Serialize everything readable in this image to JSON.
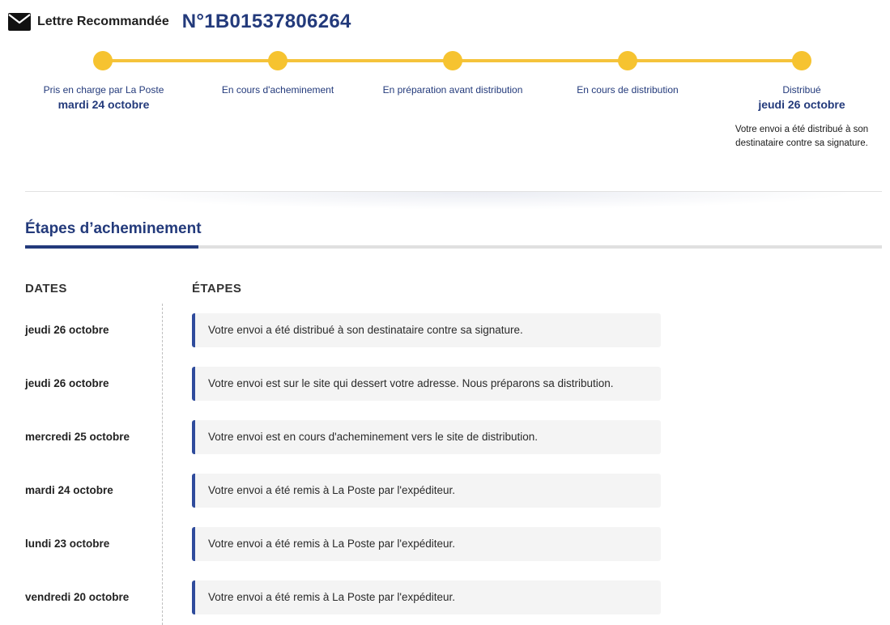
{
  "header": {
    "icon": "envelope-icon",
    "product": "Lettre Recommandée",
    "tracking_number": "N°1B01537806264"
  },
  "progress": {
    "accent_color": "#f6c330",
    "steps": [
      {
        "label": "Pris en charge par La Poste",
        "date": "mardi 24 octobre"
      },
      {
        "label": "En cours d'acheminement",
        "date": ""
      },
      {
        "label": "En préparation avant distribution",
        "date": ""
      },
      {
        "label": "En cours de distribution",
        "date": ""
      },
      {
        "label": "Distribué",
        "date": "jeudi 26 octobre",
        "note": "Votre envoi a été distribué à son destinataire contre sa signature."
      }
    ]
  },
  "section": {
    "title": "Étapes d’acheminement",
    "title_color": "#233a7b"
  },
  "table": {
    "col_dates": "DATES",
    "col_steps": "ÉTAPES",
    "bar_color": "#2f4b9c",
    "rows": [
      {
        "date": "jeudi 26 octobre",
        "text": "Votre envoi a été distribué à son destinataire contre sa signature."
      },
      {
        "date": "jeudi 26 octobre",
        "text": "Votre envoi est sur le site qui dessert votre adresse. Nous préparons sa distribution."
      },
      {
        "date": "mercredi 25 octobre",
        "text": "Votre envoi est en cours d'acheminement vers le site de distribution."
      },
      {
        "date": "mardi 24 octobre",
        "text": "Votre envoi a été remis à La Poste par l'expéditeur."
      },
      {
        "date": "lundi 23 octobre",
        "text": "Votre envoi a été remis à La Poste par l'expéditeur."
      },
      {
        "date": "vendredi 20 octobre",
        "text": "Votre envoi a été remis à La Poste par l'expéditeur."
      }
    ]
  }
}
